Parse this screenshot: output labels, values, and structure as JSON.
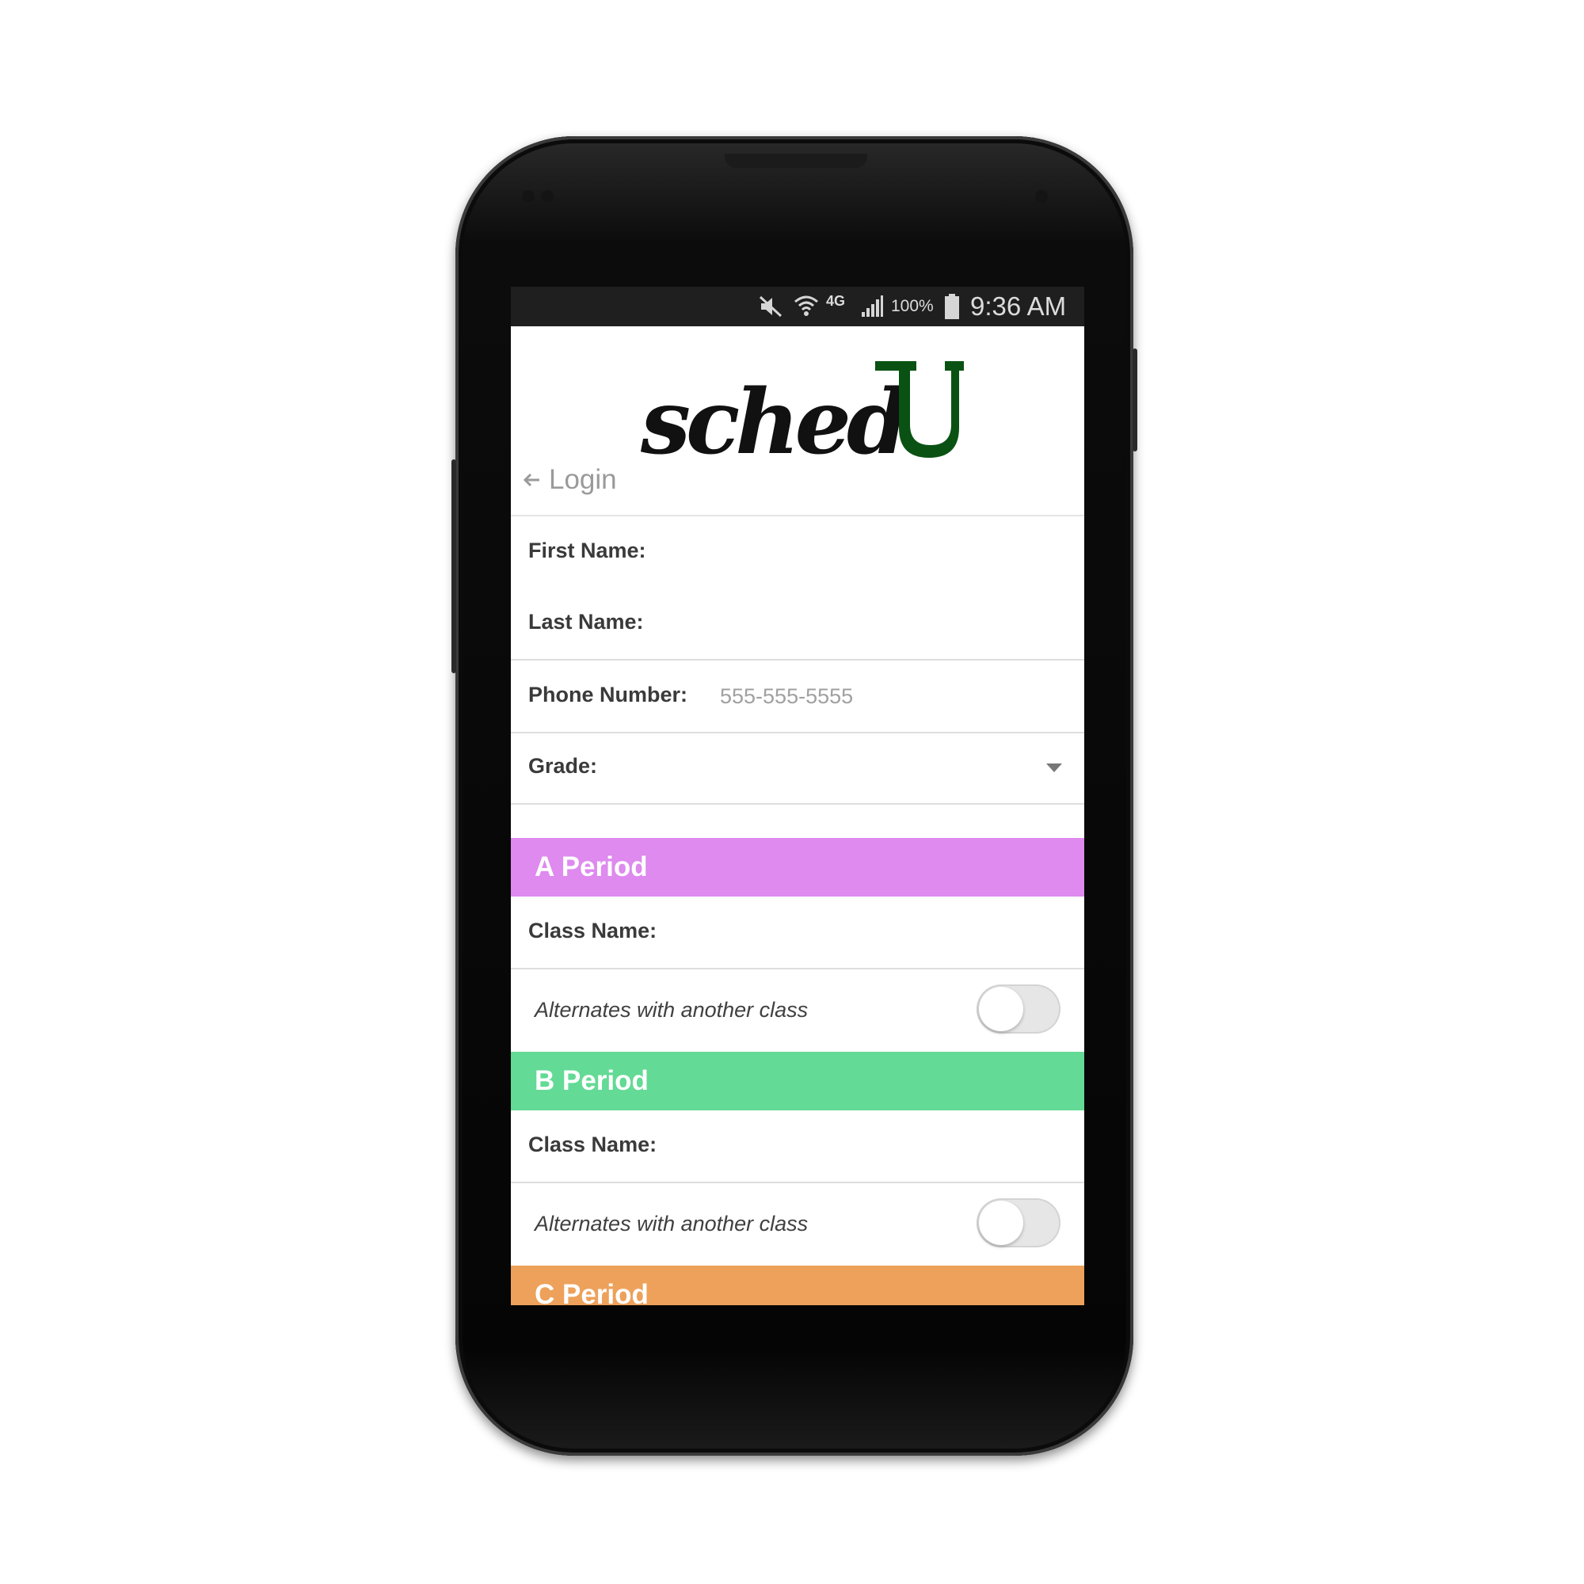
{
  "colors": {
    "a_period": "#de8aee",
    "b_period": "#63da95",
    "c_period": "#eda15a",
    "logo_green": "#0a5214"
  },
  "status_bar": {
    "icons": [
      "mute-icon",
      "wifi-icon",
      "4g-icon",
      "signal-icon",
      "battery-icon"
    ],
    "network": "4G",
    "battery": "100%",
    "time": "9:36 AM"
  },
  "header": {
    "logo_text": "schedU",
    "back_label": "Login"
  },
  "form": {
    "first_name_label": "First Name:",
    "last_name_label": "Last Name:",
    "phone_label": "Phone Number:",
    "phone_placeholder": "555-555-5555",
    "grade_label": "Grade:"
  },
  "periods": [
    {
      "title": "A Period",
      "class_name_label": "Class Name:",
      "alternates_label": "Alternates with another class",
      "alternates_on": false
    },
    {
      "title": "B Period",
      "class_name_label": "Class Name:",
      "alternates_label": "Alternates with another class",
      "alternates_on": false
    },
    {
      "title": "C Period"
    }
  ]
}
